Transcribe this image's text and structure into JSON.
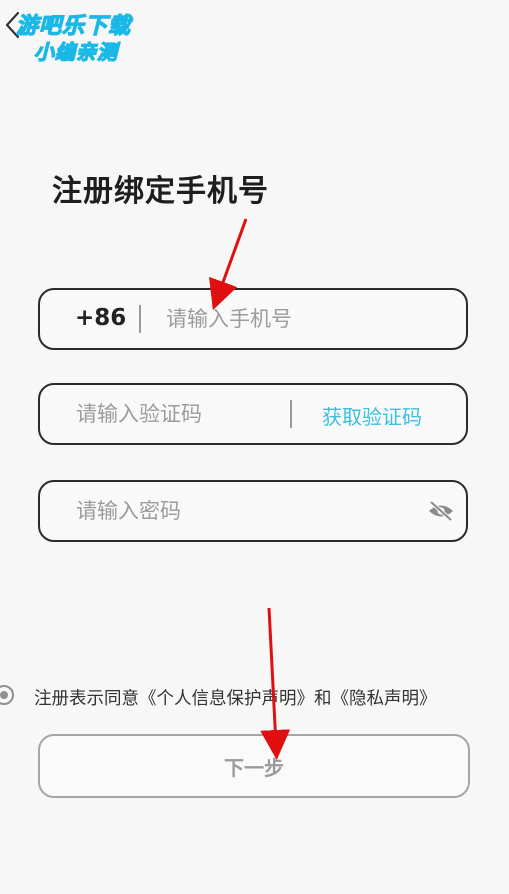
{
  "watermark": {
    "line1": "游吧乐下载",
    "line2": "小编亲测"
  },
  "header": {
    "back_icon": "chevron-left-icon"
  },
  "page_title": "注册绑定手机号",
  "phone": {
    "country_code": "+86",
    "placeholder": "请输入手机号",
    "value": ""
  },
  "code": {
    "placeholder": "请输入验证码",
    "value": "",
    "get_code_label": "获取验证码"
  },
  "password": {
    "placeholder": "请输入密码",
    "value": "",
    "visibility_icon": "eye-off-icon"
  },
  "agreement": {
    "text": "注册表示同意《个人信息保护声明》和《隐私声明》",
    "checked": false
  },
  "next_button": {
    "label": "下一步"
  },
  "colors": {
    "accent": "#3cbfe0",
    "annotation_arrow": "#e01010",
    "border": "#2b2b2b",
    "disabled": "#a6a6a6"
  }
}
